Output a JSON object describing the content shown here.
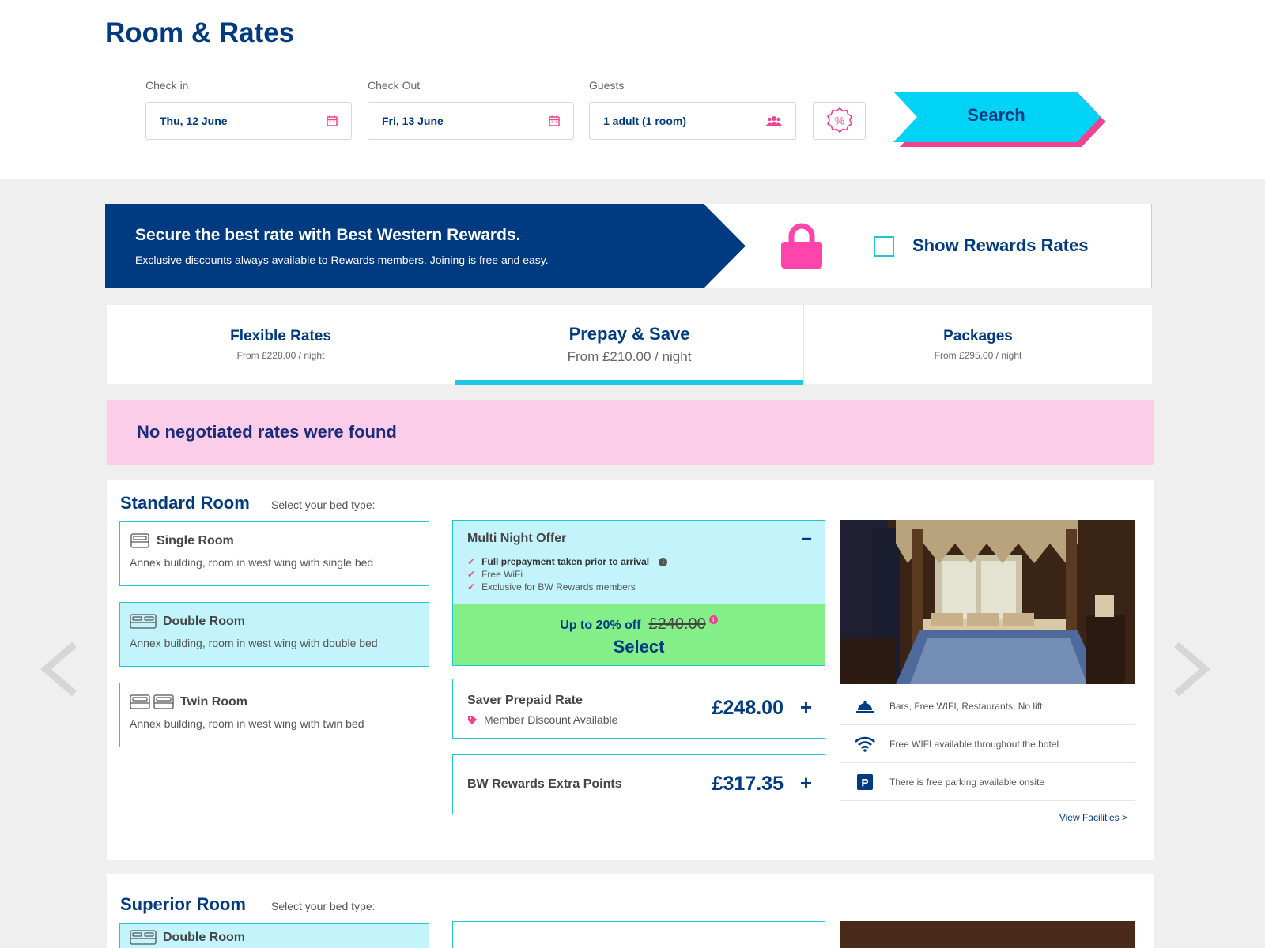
{
  "page": {
    "title": "Room & Rates"
  },
  "search": {
    "checkin_label": "Check in",
    "checkin_value": "Thu, 12 June",
    "checkout_label": "Check Out",
    "checkout_value": "Fri, 13 June",
    "guests_label": "Guests",
    "guests_value": "1 adult (1 room)",
    "button_label": "Search",
    "promo_icon": "percent-badge-icon"
  },
  "rewards": {
    "title": "Secure the best rate with Best Western Rewards.",
    "subtitle": "Exclusive discounts always available to Rewards members. Joining is free and easy.",
    "toggle_label": "Show Rewards Rates",
    "toggle_checked": false
  },
  "tabs": [
    {
      "name": "Flexible Rates",
      "sub": "From £228.00 / night",
      "active": false
    },
    {
      "name": "Prepay & Save",
      "sub": "From £210.00 / night",
      "active": true
    },
    {
      "name": "Packages",
      "sub": "From £295.00 / night",
      "active": false
    }
  ],
  "notice": "No negotiated rates were found",
  "rooms": [
    {
      "title": "Standard Room",
      "bed_prompt": "Select your bed type:",
      "beds": [
        {
          "name": "Single Room",
          "desc": "Annex building, room in west wing with single bed",
          "selected": false
        },
        {
          "name": "Double Room",
          "desc": "Annex building, room in west wing with double bed",
          "selected": true
        },
        {
          "name": "Twin Room",
          "desc": "Annex building, room in west wing with twin bed",
          "selected": false
        }
      ],
      "offer": {
        "title": "Multi Night Offer",
        "collapse": "−",
        "features": [
          "Full prepayment taken prior to arrival",
          "Free WiFi",
          "Exclusive for BW Rewards members"
        ],
        "discount": "Up to 20% off",
        "original_price": "£240.00",
        "select_label": "Select"
      },
      "rates": [
        {
          "name": "Saver Prepaid Rate",
          "note": "Member Discount Available",
          "price": "£248.00",
          "expand": "+"
        },
        {
          "name": "BW Rewards Extra Points",
          "note": "",
          "price": "£317.35",
          "expand": "+"
        }
      ],
      "facilities": [
        {
          "icon": "concierge-bell-icon",
          "text": "Bars, Free WIFI, Restaurants, No lift"
        },
        {
          "icon": "wifi-icon",
          "text": "Free WIFI available throughout the hotel"
        },
        {
          "icon": "parking-icon",
          "text": "There is free parking available onsite"
        }
      ],
      "view_facilities": "View  Facilities >"
    },
    {
      "title": "Superior Room",
      "bed_prompt": "Select your bed type:",
      "beds": [
        {
          "name": "Double Room",
          "selected": true
        }
      ]
    }
  ],
  "colors": {
    "navy": "#003a80",
    "cyan": "#00d3f5",
    "pink": "#f0438f",
    "light_cyan": "#c3f3fb",
    "green": "#84ef89",
    "notice_pink": "#fbcde9"
  }
}
